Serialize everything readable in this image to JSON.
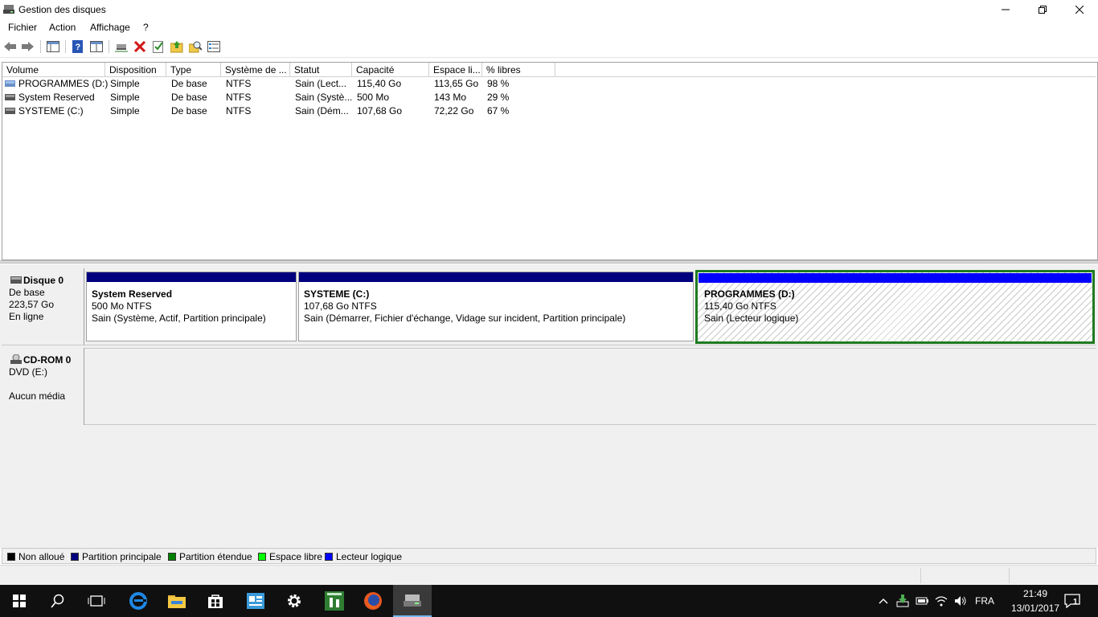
{
  "window": {
    "title": "Gestion des disques"
  },
  "menu": [
    "Fichier",
    "Action",
    "Affichage",
    "?"
  ],
  "columns": [
    "Volume",
    "Disposition",
    "Type",
    "Système de ...",
    "Statut",
    "Capacité",
    "Espace li...",
    "% libres"
  ],
  "volumes": [
    {
      "volume": "PROGRAMMES (D:)",
      "disposition": "Simple",
      "type": "De base",
      "fs": "NTFS",
      "status": "Sain (Lect...",
      "capacity": "115,40 Go",
      "free": "113,65 Go",
      "pct": "98 %"
    },
    {
      "volume": "System Reserved",
      "disposition": "Simple",
      "type": "De base",
      "fs": "NTFS",
      "status": "Sain (Systè...",
      "capacity": "500 Mo",
      "free": "143 Mo",
      "pct": "29 %"
    },
    {
      "volume": "SYSTEME (C:)",
      "disposition": "Simple",
      "type": "De base",
      "fs": "NTFS",
      "status": "Sain (Dém...",
      "capacity": "107,68 Go",
      "free": "72,22 Go",
      "pct": "67 %"
    }
  ],
  "disk0": {
    "name": "Disque 0",
    "type": "De base",
    "size": "223,57 Go",
    "state": "En ligne",
    "partitions": [
      {
        "name": "System Reserved",
        "size": "500 Mo NTFS",
        "status": "Sain (Système, Actif, Partition principale)",
        "color": "#00007f"
      },
      {
        "name": "SYSTEME  (C:)",
        "size": "107,68 Go NTFS",
        "status": "Sain (Démarrer, Fichier d'échange, Vidage sur incident, Partition principale)",
        "color": "#00007f"
      },
      {
        "name": "PROGRAMMES  (D:)",
        "size": "115,40 Go NTFS",
        "status": "Sain (Lecteur logique)",
        "color": "#0000ff"
      }
    ]
  },
  "cdrom0": {
    "name": "CD-ROM 0",
    "drive": "DVD (E:)",
    "media": "Aucun média"
  },
  "legend": [
    {
      "label": "Non alloué",
      "color": "#000000"
    },
    {
      "label": "Partition principale",
      "color": "#00007f"
    },
    {
      "label": "Partition étendue",
      "color": "#007f00"
    },
    {
      "label": "Espace libre",
      "color": "#00ff00"
    },
    {
      "label": "Lecteur logique",
      "color": "#0000ff"
    }
  ],
  "taskbar": {
    "icons": [
      "start-icon",
      "search-icon",
      "task-view-icon",
      "edge-icon",
      "file-explorer-icon",
      "store-icon",
      "app-icon",
      "settings-icon",
      "game-icon",
      "firefox-icon",
      "disk-management-icon"
    ],
    "lang": "FRA",
    "time": "21:49",
    "date": "13/01/2017",
    "notifications": "1"
  }
}
